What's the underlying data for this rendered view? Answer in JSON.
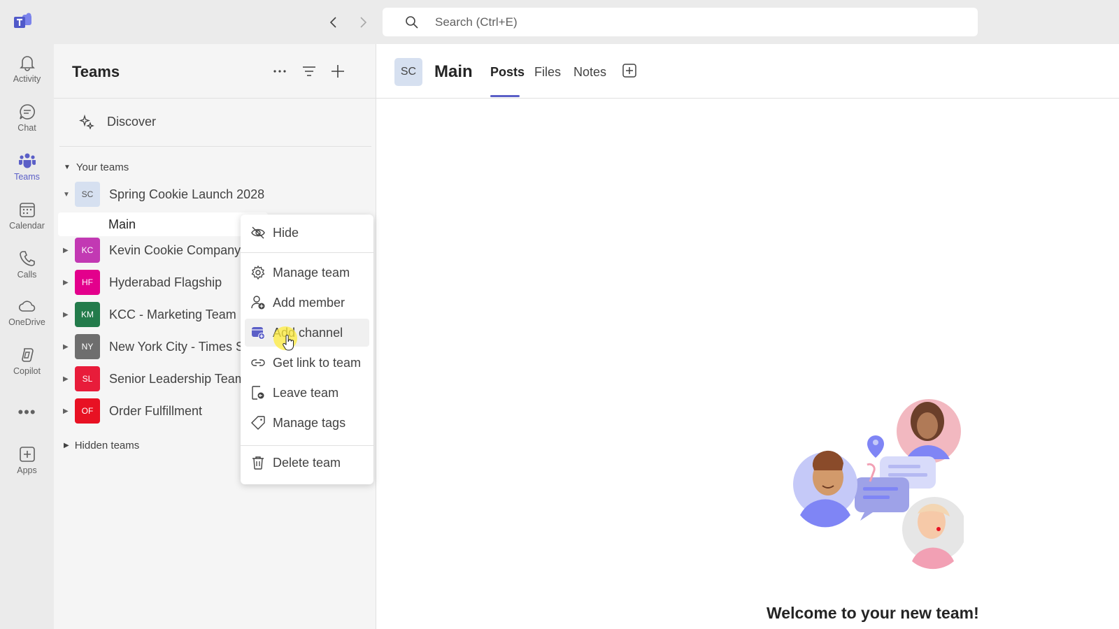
{
  "search": {
    "placeholder": "Search (Ctrl+E)"
  },
  "rail": {
    "items": [
      {
        "label": "Activity",
        "icon": "bell-icon"
      },
      {
        "label": "Chat",
        "icon": "chat-icon"
      },
      {
        "label": "Teams",
        "icon": "teams-icon",
        "active": true
      },
      {
        "label": "Calendar",
        "icon": "calendar-icon"
      },
      {
        "label": "Calls",
        "icon": "phone-icon"
      },
      {
        "label": "OneDrive",
        "icon": "cloud-icon"
      },
      {
        "label": "Copilot",
        "icon": "copilot-icon"
      },
      {
        "label": "Apps",
        "icon": "apps-icon"
      }
    ],
    "more_label": "•••"
  },
  "panel": {
    "title": "Teams",
    "discover_label": "Discover",
    "your_teams_label": "Your teams",
    "hidden_teams_label": "Hidden teams",
    "teams": [
      {
        "initials": "SC",
        "name": "Spring Cookie Launch 2028",
        "color": "#d6e0f0",
        "expanded": true
      },
      {
        "initials": "KC",
        "name": "Kevin Cookie Company",
        "color": "#c239b3"
      },
      {
        "initials": "HF",
        "name": "Hyderabad Flagship",
        "color": "#e3008c"
      },
      {
        "initials": "KM",
        "name": "KCC - Marketing Team",
        "color": "#237b4b"
      },
      {
        "initials": "NY",
        "name": "New York City - Times S",
        "color": "#6e6e6e"
      },
      {
        "initials": "SL",
        "name": "Senior Leadership Team",
        "color": "#e81c3a"
      },
      {
        "initials": "OF",
        "name": "Order Fulfillment",
        "color": "#e81123"
      }
    ],
    "channel": "Main"
  },
  "menu": {
    "items": [
      {
        "label": "Hide",
        "icon": "hide-icon"
      },
      {
        "label": "Manage team",
        "icon": "gear-icon"
      },
      {
        "label": "Add member",
        "icon": "add-person-icon"
      },
      {
        "label": "Add channel",
        "icon": "add-channel-icon"
      },
      {
        "label": "Get link to team",
        "icon": "link-icon"
      },
      {
        "label": "Leave team",
        "icon": "leave-icon"
      },
      {
        "label": "Manage tags",
        "icon": "tag-icon"
      },
      {
        "label": "Delete team",
        "icon": "trash-icon"
      }
    ]
  },
  "main": {
    "avatar": "SC",
    "title": "Main",
    "tabs": [
      "Posts",
      "Files",
      "Notes"
    ],
    "active_tab": "Posts",
    "welcome": "Welcome to your new team!"
  },
  "colors": {
    "accent": "#5b5fc7",
    "rail_bg": "#ebebeb",
    "panel_bg": "#f5f5f5"
  }
}
